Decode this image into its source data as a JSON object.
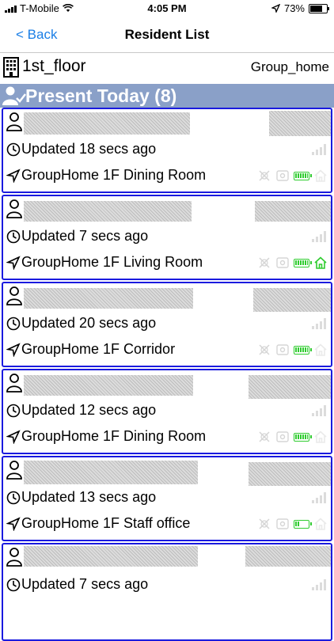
{
  "status": {
    "carrier": "T-Mobile",
    "time": "4:05 PM",
    "battery": "73%",
    "battery_level": 0.73
  },
  "nav": {
    "back_label": "< Back",
    "title": "Resident List"
  },
  "floor": {
    "name": "1st_floor",
    "group": "Group_home"
  },
  "section": {
    "title": "Present Today (8)"
  },
  "residents": [
    {
      "updated": "Updated 18 secs ago",
      "location": "GroupHome 1F Dining Room",
      "battery_level": 1.0,
      "home": false
    },
    {
      "updated": "Updated 7 secs ago",
      "location": "GroupHome 1F Living Room",
      "battery_level": 1.0,
      "home": true
    },
    {
      "updated": "Updated 20 secs ago",
      "location": "GroupHome 1F Corridor",
      "battery_level": 1.0,
      "home": false
    },
    {
      "updated": "Updated 12 secs ago",
      "location": "GroupHome 1F Dining Room",
      "battery_level": 1.0,
      "home": false
    },
    {
      "updated": "Updated 13 secs ago",
      "location": "GroupHome 1F Staff office",
      "battery_level": 0.4,
      "home": false
    },
    {
      "updated": "Updated 7 secs ago",
      "location": "",
      "battery_level": null,
      "home": false
    }
  ],
  "colors": {
    "accent": "#1a7ee6",
    "card_border": "#1a1adf",
    "section_bg": "#8aa0c8",
    "battery_green": "#2fcc2f",
    "home_green": "#2fcc2f"
  }
}
